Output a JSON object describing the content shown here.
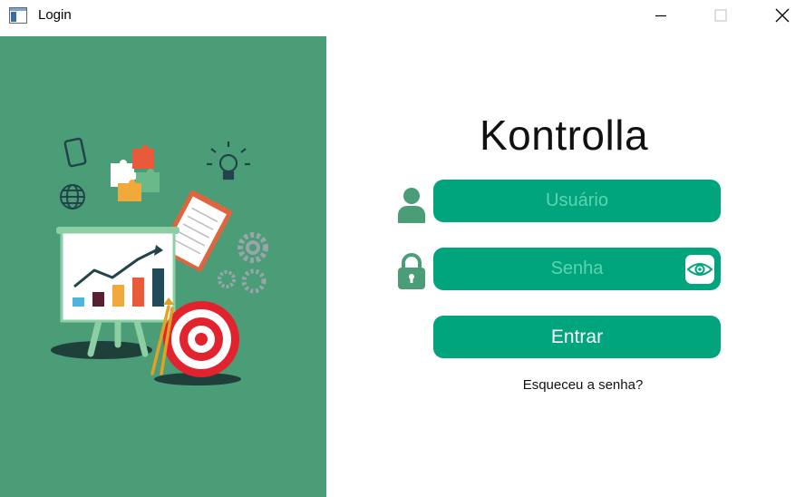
{
  "window": {
    "title": "Login",
    "icon": "app-window-icon",
    "controls": [
      "minimize-icon",
      "maximize-icon",
      "close-icon"
    ]
  },
  "illustration": {
    "description_icons": [
      "smartphone-icon",
      "puzzle-icon",
      "lightbulb-icon",
      "globe-icon",
      "notepad-icon",
      "gear-icon",
      "presentation-board-icon",
      "target-icon",
      "arrow-icon"
    ]
  },
  "login": {
    "brand": "Kontrolla",
    "username_placeholder": "Usuário",
    "password_placeholder": "Senha",
    "submit_label": "Entrar",
    "forgot_label": "Esqueceu a senha?"
  },
  "colors": {
    "panel": "#4a9d77",
    "accent": "#00a57d",
    "placeholder": "#5fd3b0"
  }
}
